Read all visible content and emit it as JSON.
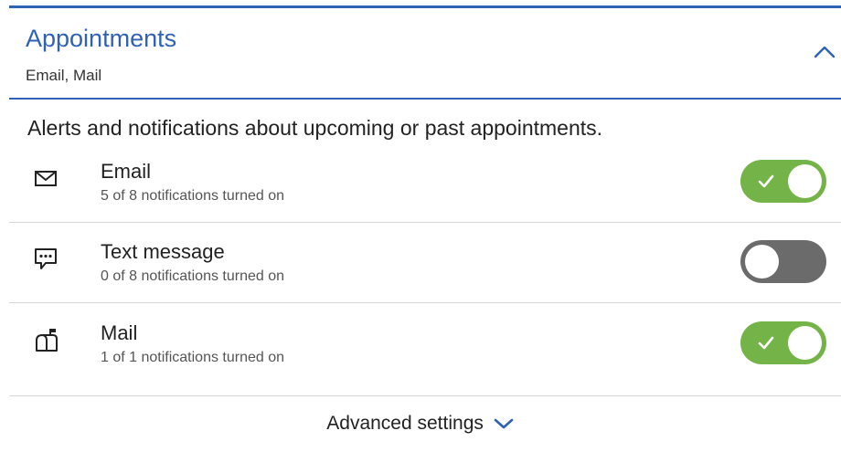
{
  "section": {
    "title": "Appointments",
    "subtitle": "Email, Mail",
    "expanded": true
  },
  "description": "Alerts and notifications about upcoming or past appointments.",
  "channels": [
    {
      "label": "Email",
      "status": "5 of 8 notifications turned on",
      "enabled": true,
      "icon": "envelope-icon"
    },
    {
      "label": "Text message",
      "status": "0 of 8 notifications turned on",
      "enabled": false,
      "icon": "chat-bubble-icon"
    },
    {
      "label": "Mail",
      "status": "1 of 1 notifications turned on",
      "enabled": true,
      "icon": "mailbox-icon"
    }
  ],
  "advanced": {
    "label": "Advanced settings"
  },
  "colors": {
    "accent": "#2f62b5",
    "toggle_on": "#73b347",
    "toggle_off": "#6b6b6b"
  }
}
